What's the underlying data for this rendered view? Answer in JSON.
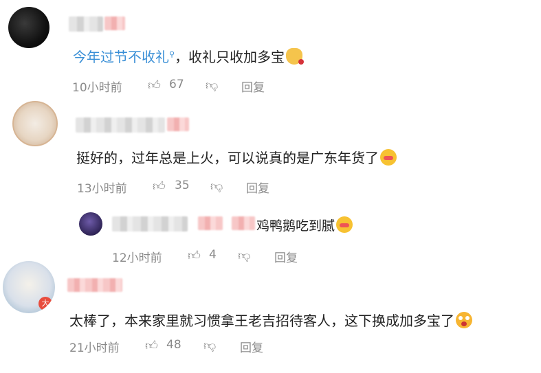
{
  "comments": [
    {
      "text_topic": "今年过节不收礼",
      "text_rest": "，收礼只收加多宝",
      "time": "10小时前",
      "likes": "67",
      "reply_label": "回复"
    },
    {
      "text": "挺好的，过年总是上火，可以说真的是广东年货了",
      "time": "13小时前",
      "likes": "35",
      "reply_label": "回复"
    },
    {
      "text": "鸡鸭鹅吃到腻",
      "time": "12小时前",
      "likes": "4",
      "reply_label": "回复"
    },
    {
      "badge": "大",
      "text": "太棒了，本来家里就习惯拿王老吉招待客人，这下换成加多宝了",
      "time": "21小时前",
      "likes": "48",
      "reply_label": "回复"
    }
  ],
  "icons": {
    "like": "thumbs-up-icon",
    "dislike": "thumbs-down-icon",
    "topic": "search-icon"
  },
  "colors": {
    "topic": "#3a8fd6",
    "meta": "#8a8a8a"
  }
}
